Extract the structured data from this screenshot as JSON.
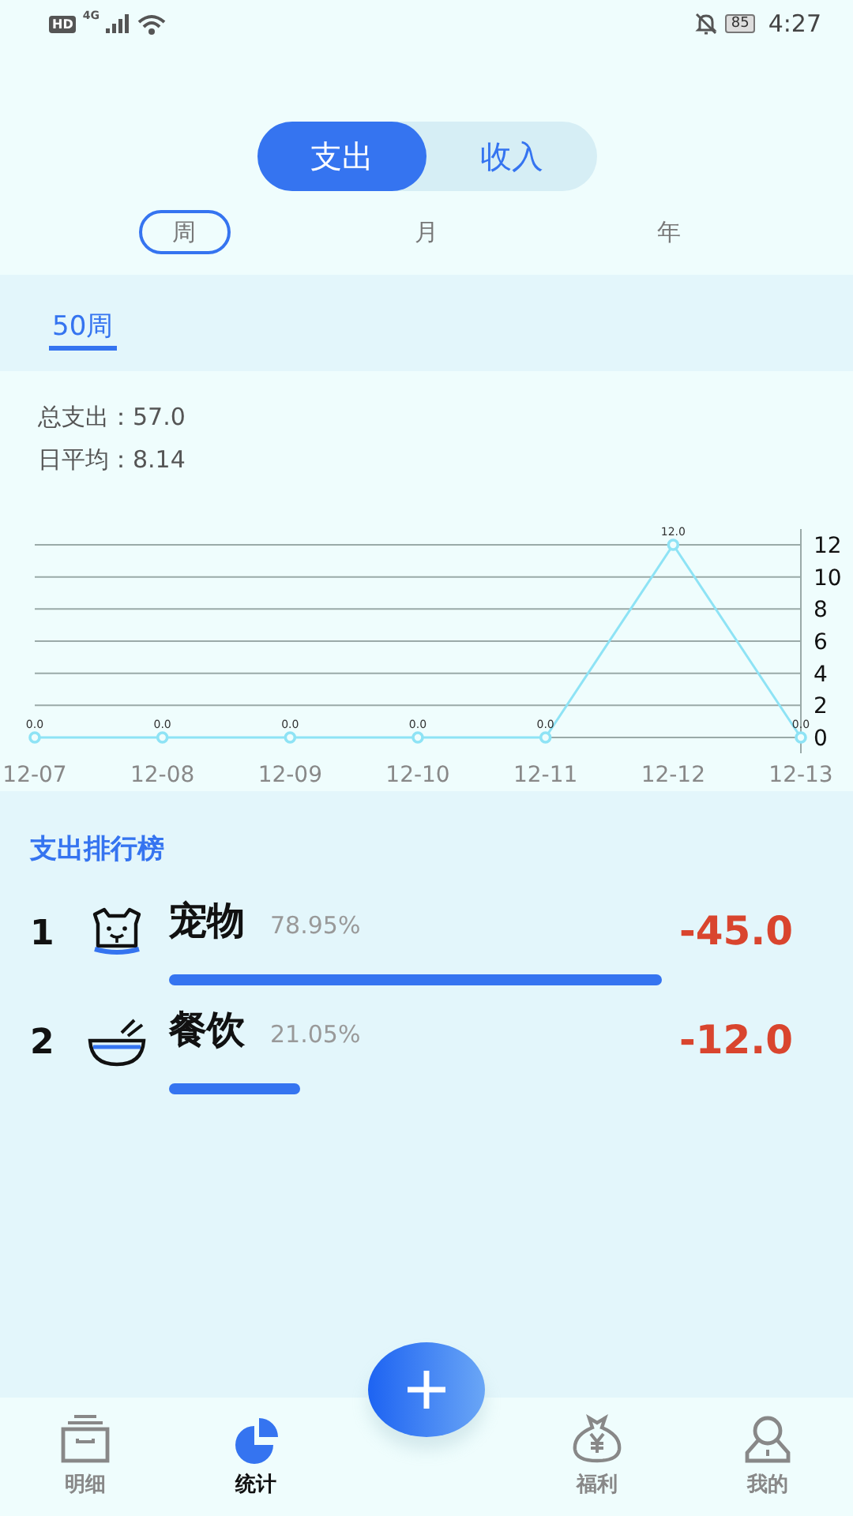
{
  "status_bar": {
    "hd": "HD",
    "network": "4G",
    "battery": "85",
    "time": "4:27"
  },
  "type_toggle": [
    {
      "label": "支出",
      "selected": true
    },
    {
      "label": "收入",
      "selected": false
    }
  ],
  "period_tabs": [
    {
      "label": "周",
      "selected": true
    },
    {
      "label": "月",
      "selected": false
    },
    {
      "label": "年",
      "selected": false
    }
  ],
  "weeks": [
    {
      "label": "50周",
      "selected": true
    }
  ],
  "summary": {
    "total": "总支出：57.0",
    "daily_average": "日平均：8.14"
  },
  "chart_data": {
    "type": "line",
    "categories": [
      "12-07",
      "12-08",
      "12-09",
      "12-10",
      "12-11",
      "12-12",
      "12-13"
    ],
    "series": [
      {
        "color": "#8ee3f5",
        "marker": "circle",
        "values": [
          0,
          0,
          0,
          0,
          0,
          12,
          0
        ]
      }
    ],
    "ylim": [
      0,
      12
    ],
    "yticks": [
      0,
      2,
      4,
      6,
      8,
      10,
      12
    ],
    "grid": true,
    "value_labels": [
      "0.0",
      "0.0",
      "0.0",
      "0.0",
      "0.0",
      "12.0",
      "0.0"
    ]
  },
  "ranking": {
    "title": "支出排行榜",
    "items": [
      {
        "rank": "1",
        "kind": "pet",
        "name": "宠物",
        "percent": "78.95%",
        "amount": "-45.0"
      },
      {
        "rank": "2",
        "kind": "food",
        "name": "餐饮",
        "percent": "21.05%",
        "amount": "-12.0"
      }
    ]
  },
  "bottom_nav": [
    {
      "label": "明细",
      "kind": "box",
      "selected": false
    },
    {
      "label": "统计",
      "kind": "pie",
      "selected": true
    },
    {
      "kind": "add"
    },
    {
      "label": "福利",
      "kind": "bag",
      "selected": false
    },
    {
      "label": "我的",
      "kind": "person",
      "selected": false
    }
  ]
}
